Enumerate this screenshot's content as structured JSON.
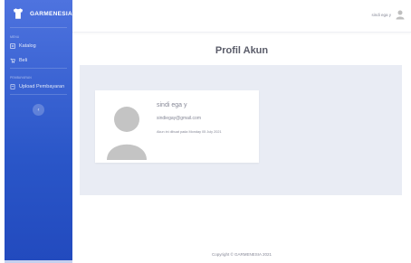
{
  "brand": {
    "name": "GARMENESIA"
  },
  "sidebar": {
    "heading1": "Menu",
    "items": [
      {
        "label": "Katalog",
        "icon": "catalog-icon"
      },
      {
        "label": "Beli",
        "icon": "cart-icon"
      }
    ],
    "heading2": "Pembayaran",
    "items2": [
      {
        "label": "Upload Pembayaran",
        "icon": "upload-icon"
      }
    ],
    "toggle_glyph": "‹"
  },
  "topbar": {
    "user_name": "sindi ega y"
  },
  "page": {
    "title": "Profil Akun"
  },
  "profile": {
    "name": "sindi ega y",
    "email": "sindiegay@gmail.com",
    "created": "Akun ini dibuat pada Monday 05 July 2021"
  },
  "footer": {
    "text": "Copyright © GARMENESIA 2021"
  },
  "colors": {
    "sidebar": "#4e73df",
    "panel": "#e9ecf4",
    "text_muted": "#858796"
  }
}
